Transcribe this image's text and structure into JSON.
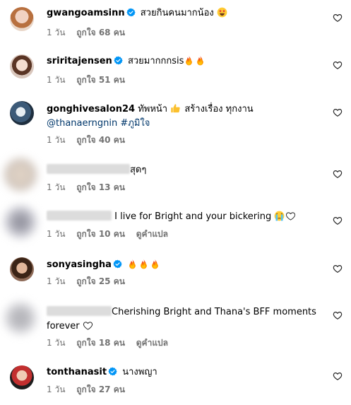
{
  "comments": [
    {
      "username": "gwangoamsinn",
      "verified": true,
      "text": "สวยกินคนมากน้อง",
      "emojis": [
        "star-struck"
      ],
      "time": "1 วัน",
      "likes": "ถูกใจ 68 คน",
      "translate": ""
    },
    {
      "username": "sriritajensen",
      "verified": true,
      "text": "สวยมากกกsis",
      "emojis": [
        "fire",
        "fire"
      ],
      "time": "1 วัน",
      "likes": "ถูกใจ 51 คน",
      "translate": ""
    },
    {
      "username": "gonghivesalon24",
      "verified": false,
      "text_before": "ทัพหน้า",
      "text_after": "สร้างเรื่อง ทุกงาน",
      "mention": "@thanaerngnin",
      "hashtag": "#ภูมิใจ",
      "emojis": [
        "thumbs-up"
      ],
      "time": "1 วัน",
      "likes": "ถูกใจ 40 คน",
      "translate": ""
    },
    {
      "username": "",
      "verified": false,
      "text": "สุดๆ",
      "emojis": [],
      "time": "1 วัน",
      "likes": "ถูกใจ 13 คน",
      "translate": ""
    },
    {
      "username": "",
      "verified": false,
      "text": "I live for Bright and your bickering",
      "emojis": [
        "crying-face",
        "white-heart"
      ],
      "time": "1 วัน",
      "likes": "ถูกใจ 10 คน",
      "translate": "ดูคำแปล"
    },
    {
      "username": "sonyasingha",
      "verified": true,
      "text": "",
      "emojis": [
        "fire",
        "fire",
        "fire"
      ],
      "time": "1 วัน",
      "likes": "ถูกใจ 25 คน",
      "translate": ""
    },
    {
      "username": "",
      "verified": false,
      "text": "Cherishing Bright and Thana's BFF moments forever",
      "emojis": [
        "white-heart"
      ],
      "time": "1 วัน",
      "likes": "ถูกใจ 18 คน",
      "translate": "ดูคำแปล"
    },
    {
      "username": "tonthanasit",
      "verified": true,
      "text": "นางพญา",
      "emojis": [],
      "time": "1 วัน",
      "likes": "ถูกใจ 27 คน",
      "translate": ""
    }
  ],
  "icons": {
    "verified_badge": "verified-badge-icon",
    "like": "heart-outline-icon"
  },
  "colors": {
    "verified_blue": "#0095f6",
    "mention_link": "#00376b",
    "meta_gray": "#737373"
  }
}
